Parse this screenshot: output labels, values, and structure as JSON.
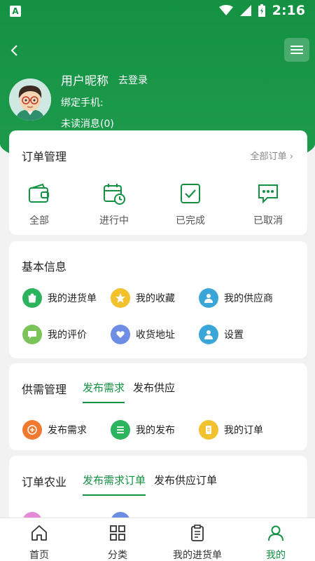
{
  "status_bar": {
    "app_badge": "A",
    "time": "2:16"
  },
  "user": {
    "nickname": "用户昵称",
    "login_link": "去登录",
    "bind_phone_label": "绑定手机:",
    "unread_messages": "未读消息(0)"
  },
  "order_management": {
    "title": "订单管理",
    "all_orders_link": "全部订单",
    "items": [
      {
        "label": "全部",
        "icon": "wallet-icon"
      },
      {
        "label": "进行中",
        "icon": "calendar-clock-icon"
      },
      {
        "label": "已完成",
        "icon": "check-square-icon"
      },
      {
        "label": "已取消",
        "icon": "chat-dots-icon"
      }
    ]
  },
  "basic_info": {
    "title": "基本信息",
    "items": [
      {
        "label": "我的进货单",
        "icon": "bag-icon",
        "color": "#2bb35e"
      },
      {
        "label": "我的收藏",
        "icon": "star-icon",
        "color": "#f2c12e"
      },
      {
        "label": "我的供应商",
        "icon": "person-icon",
        "color": "#3aa5d8"
      },
      {
        "label": "我的评价",
        "icon": "comment-icon",
        "color": "#7ac45a"
      },
      {
        "label": "收货地址",
        "icon": "heart-hand-icon",
        "color": "#6e8ee6"
      },
      {
        "label": "设置",
        "icon": "person-icon",
        "color": "#3aa5d8"
      }
    ]
  },
  "supply_demand": {
    "title": "供需管理",
    "tabs": [
      "发布需求",
      "发布供应"
    ],
    "active_tab": 0,
    "items": [
      {
        "label": "发布需求",
        "icon": "plus-icon",
        "color": "#f07a30"
      },
      {
        "label": "我的发布",
        "icon": "list-icon",
        "color": "#2bb35e"
      },
      {
        "label": "我的订单",
        "icon": "doc-icon",
        "color": "#f2c12e"
      }
    ]
  },
  "order_agriculture": {
    "title": "订单农业",
    "tabs": [
      "发布需求订单",
      "发布供应订单"
    ],
    "active_tab": 0
  },
  "bottom_nav": {
    "items": [
      {
        "label": "首页",
        "icon": "home-icon"
      },
      {
        "label": "分类",
        "icon": "grid-icon"
      },
      {
        "label": "我的进货单",
        "icon": "clipboard-icon"
      },
      {
        "label": "我的",
        "icon": "user-icon"
      }
    ],
    "active": 3
  },
  "colors": {
    "brand": "#149143",
    "background": "#f2f2f2"
  }
}
